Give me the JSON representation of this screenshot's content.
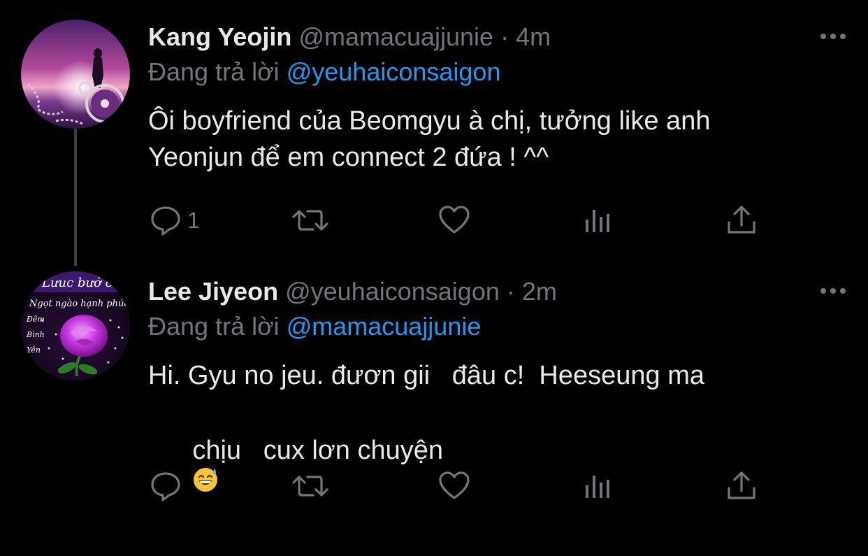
{
  "tweets": [
    {
      "name": "Kang Yeojin",
      "handle": "@mamacuajjunie",
      "separator": "·",
      "time": "4m",
      "reply_prefix": "Đang trả lời",
      "reply_to": "@yeuhaiconsaigon",
      "text_line1": "Ôi boyfriend của Beomgyu à chị, tưởng like anh",
      "text_line2": "Yeonjun để em connect 2 đứa ! ^^",
      "reply_count": "1",
      "avatar_icon": "sunset-woman-avatar"
    },
    {
      "name": "Lee Jiyeon",
      "handle": "@yeuhaiconsaigon",
      "separator": "·",
      "time": "2m",
      "reply_prefix": "Đang trả lời",
      "reply_to": "@mamacuajjunie",
      "text_line1": "Hi. Gyu no jeu. đươn gii   đâu c!  Heeseung ma",
      "text_line2": "chịu   cux lơn chuyện",
      "emoji": "😅",
      "reply_count": "",
      "avatar_icon": "purple-rose-avatar",
      "avatar_text": {
        "top": "Lưuc bướ c",
        "line1": "Ngọt ngào hạnh phúc",
        "w1": "Đêm",
        "w2": "Bình",
        "w3": "Yên"
      }
    }
  ],
  "colors": {
    "background": "#000000",
    "text": "#e7e9ea",
    "muted": "#71767b",
    "link": "#1d9bf0",
    "thread_line": "#3e4144"
  }
}
